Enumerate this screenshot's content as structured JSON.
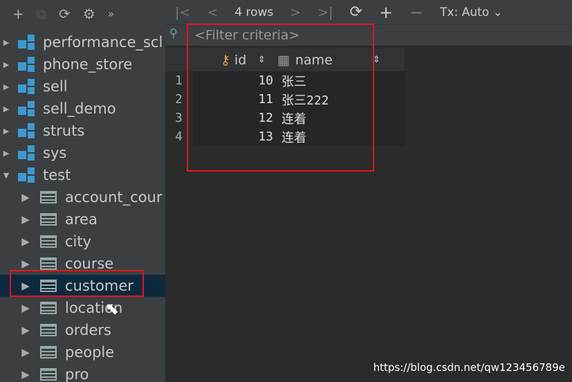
{
  "sidebar": {
    "toolbar": [
      "+",
      "⧉",
      "⟳",
      "⚙",
      "»"
    ],
    "schemas": [
      "performance_scl",
      "phone_store",
      "sell",
      "sell_demo",
      "struts",
      "sys",
      "test"
    ],
    "tables": [
      "account_cour",
      "area",
      "city",
      "course",
      "customer",
      "location",
      "orders",
      "people",
      "pro"
    ],
    "selected": "customer"
  },
  "toolbar": {
    "first": "|<",
    "prev": "<",
    "rows": "4 rows",
    "next": ">",
    "last": ">|",
    "refresh": "⟳",
    "add": "+",
    "remove": "−",
    "tx": "Tx: Auto ⌄"
  },
  "filter": {
    "placeholder": "<Filter criteria>"
  },
  "grid": {
    "columns": [
      "id",
      "name"
    ],
    "rows": [
      {
        "n": "1",
        "id": "10",
        "name": "张三"
      },
      {
        "n": "2",
        "id": "11",
        "name": "张三222"
      },
      {
        "n": "3",
        "id": "12",
        "name": "连着"
      },
      {
        "n": "4",
        "id": "13",
        "name": "连着"
      }
    ]
  },
  "highlight_color": "#e5141c",
  "watermark": "https://blog.csdn.net/qw123456789e"
}
